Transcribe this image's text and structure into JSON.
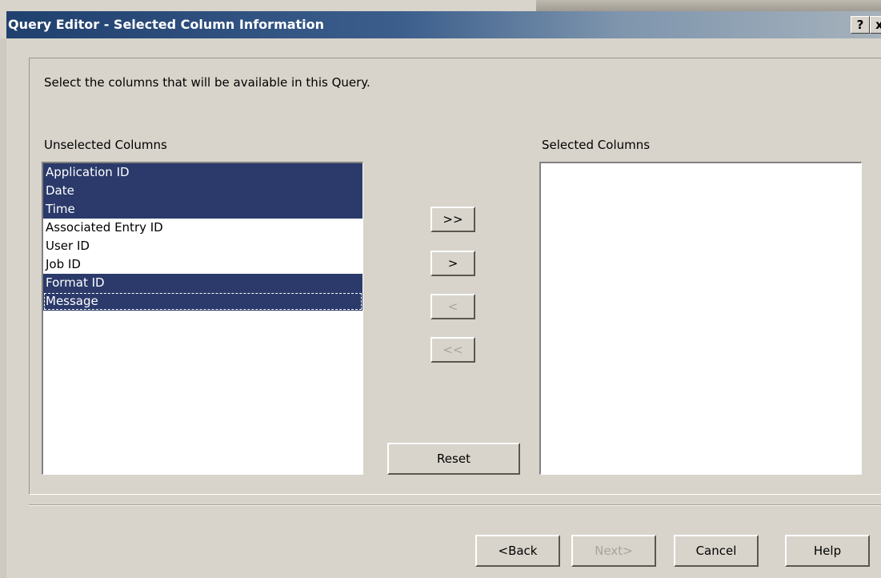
{
  "window": {
    "title": "Query Editor - Selected Column Information",
    "help_glyph": "?",
    "close_glyph": "x"
  },
  "instruction": "Select the columns that will be available in this Query.",
  "unselected": {
    "label": "Unselected Columns",
    "items": [
      {
        "label": "Application ID",
        "selected": true
      },
      {
        "label": "Date",
        "selected": true
      },
      {
        "label": "Time",
        "selected": true
      },
      {
        "label": "Associated Entry ID",
        "selected": false
      },
      {
        "label": "User ID",
        "selected": false
      },
      {
        "label": "Job ID",
        "selected": false
      },
      {
        "label": "Format ID",
        "selected": true
      },
      {
        "label": "Message",
        "selected": true
      }
    ]
  },
  "selected": {
    "label": "Selected Columns",
    "items": []
  },
  "move_buttons": {
    "add_all": ">>",
    "add": ">",
    "remove": "<",
    "remove_all": "<<",
    "reset": "Reset"
  },
  "footer": {
    "back": "<Back",
    "next": "Next>",
    "cancel": "Cancel",
    "help": "Help"
  },
  "colors": {
    "selection": "#2b3a6a",
    "dialog_bg": "#d8d4cb",
    "title_start": "#20406e"
  }
}
